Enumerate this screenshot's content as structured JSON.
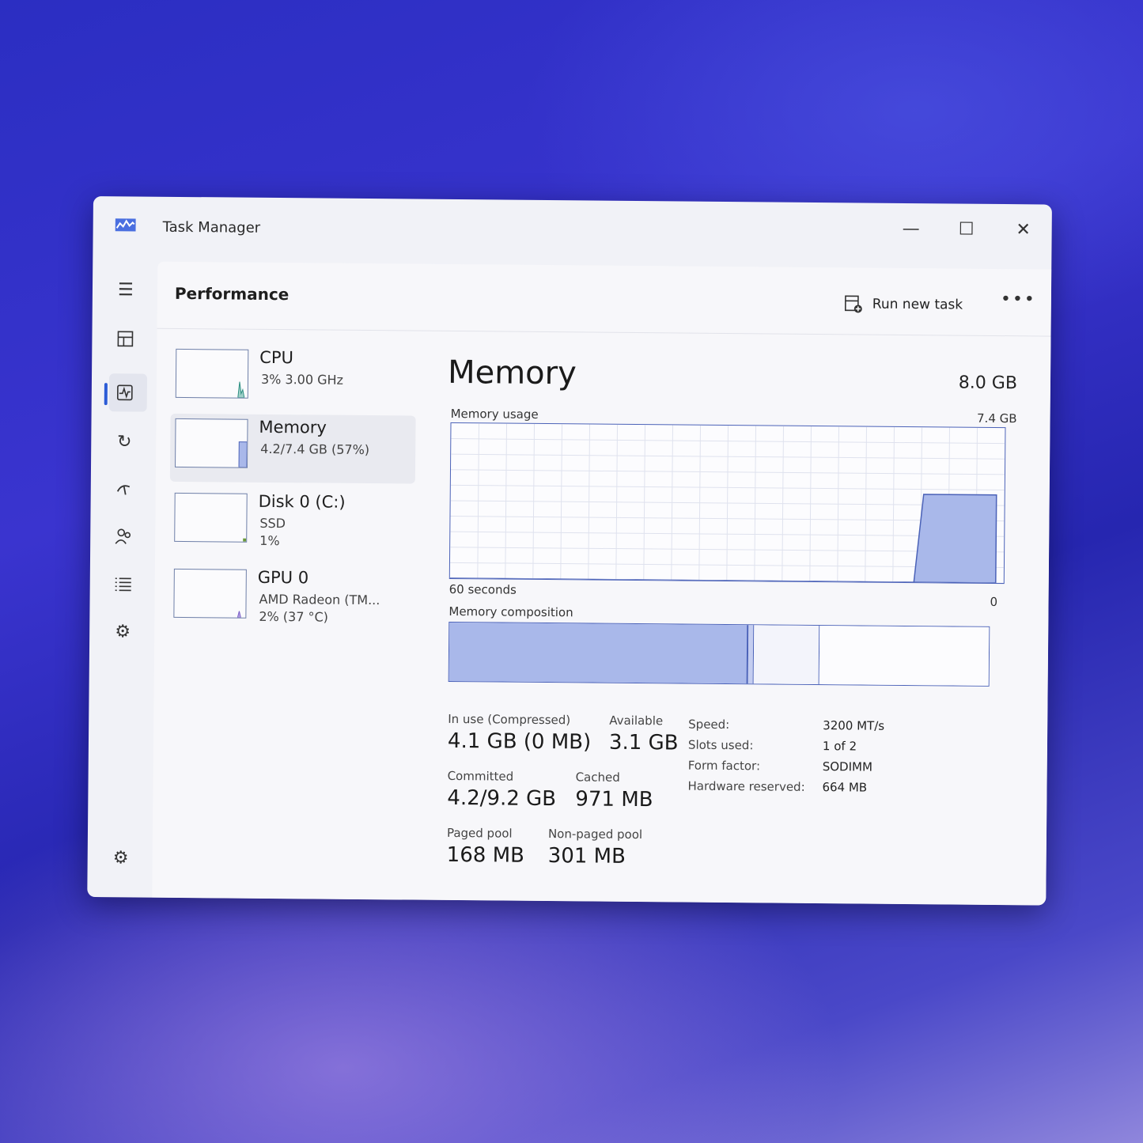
{
  "window": {
    "title": "Task Manager"
  },
  "header": {
    "page_title": "Performance",
    "run_new_task": "Run new task"
  },
  "devices": [
    {
      "name": "CPU",
      "sub1": "3% 3.00 GHz",
      "sub2": "",
      "usage_percent": 3
    },
    {
      "name": "Memory",
      "sub1": "4.2/7.4 GB (57%)",
      "sub2": "",
      "usage_percent": 57
    },
    {
      "name": "Disk 0 (C:)",
      "sub1": "SSD",
      "sub2": "1%",
      "usage_percent": 1
    },
    {
      "name": "GPU 0",
      "sub1": "AMD Radeon (TM...",
      "sub2": "2% (37 °C)",
      "usage_percent": 2
    }
  ],
  "memory": {
    "title": "Memory",
    "total": "8.0 GB",
    "usage_label": "Memory usage",
    "usage_max": "7.4 GB",
    "time_label": "60 seconds",
    "zero_label": "0",
    "composition_label": "Memory composition",
    "composition": {
      "in_use": 0.554,
      "modified": 0.01,
      "standby": 0.12,
      "free": 0.316
    },
    "stats": {
      "in_use_label": "In use (Compressed)",
      "in_use_value": "4.1 GB (0 MB)",
      "available_label": "Available",
      "available_value": "3.1 GB",
      "committed_label": "Committed",
      "committed_value": "4.2/9.2 GB",
      "cached_label": "Cached",
      "cached_value": "971 MB",
      "paged_label": "Paged pool",
      "paged_value": "168 MB",
      "nonpaged_label": "Non-paged pool",
      "nonpaged_value": "301 MB"
    },
    "specs": {
      "speed_label": "Speed:",
      "speed_value": "3200 MT/s",
      "slots_label": "Slots used:",
      "slots_value": "1 of 2",
      "form_label": "Form factor:",
      "form_value": "SODIMM",
      "reserved_label": "Hardware reserved:",
      "reserved_value": "664 MB"
    },
    "chart_data": {
      "type": "area",
      "xlabel": "60 seconds",
      "ylim": [
        0,
        7.4
      ],
      "x": [
        60,
        54,
        48,
        42,
        36,
        30,
        24,
        20,
        9,
        8,
        1,
        0
      ],
      "y": [
        0,
        0,
        0,
        0,
        0,
        0,
        0,
        0,
        0,
        4.2,
        4.2,
        4.2
      ]
    }
  },
  "colors": {
    "accent": "#4b62b8",
    "fill": "#a9b8ea",
    "background": "#f1f2f7"
  },
  "icons": [
    "task-manager-icon",
    "hamburger-icon",
    "processes-icon",
    "performance-icon",
    "app-history-icon",
    "startup-apps-icon",
    "users-icon",
    "details-icon",
    "services-icon",
    "settings-icon",
    "run-task-icon",
    "more-icon"
  ]
}
